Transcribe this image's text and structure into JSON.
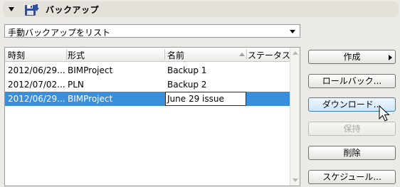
{
  "header": {
    "title": "バックアップ",
    "icon": "floppy-disk-icon"
  },
  "dropdown": {
    "value": "手動バックアップをリスト"
  },
  "table": {
    "columns": [
      "時刻",
      "形式",
      "名前",
      "ステータス"
    ],
    "sort": {
      "column": "名前",
      "direction": "ascending"
    },
    "rows": [
      {
        "time": "2012/06/29...",
        "format": "BIMProject",
        "name": "Backup 1",
        "status": ""
      },
      {
        "time": "2012/07/02...",
        "format": "PLN",
        "name": "Backup 2",
        "status": ""
      },
      {
        "time": "2012/06/29...",
        "format": "BIMProject",
        "name": "June 29 issue",
        "status": ""
      }
    ],
    "selected_row": 2,
    "editing_value": "June 29 issue"
  },
  "buttons": {
    "create": "作成",
    "rollback": "ロールバック...",
    "download": "ダウンロード...",
    "keep": "保持",
    "delete": "削除",
    "schedule": "スケジュール..."
  },
  "colors": {
    "selection": "#3a8fdc",
    "panel_bg": "#eceae4",
    "hover_button": "#cfe6fb"
  }
}
